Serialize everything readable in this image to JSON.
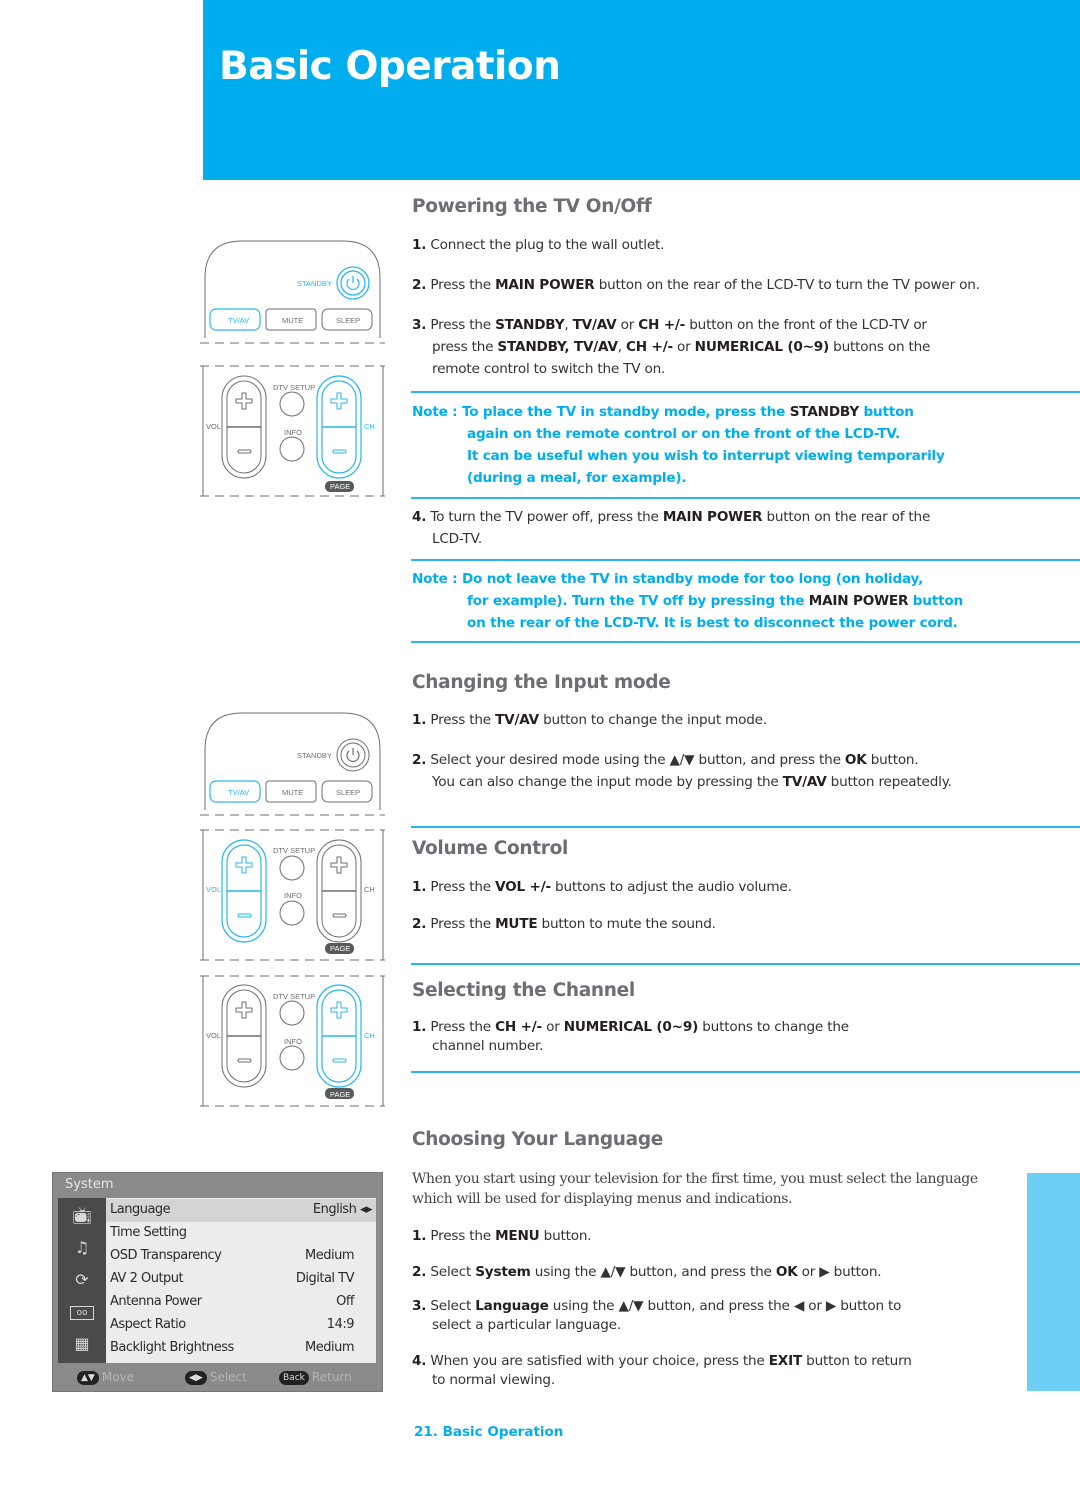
{
  "header": {
    "title": "Basic Operation"
  },
  "colors": {
    "accent": "#00aeef",
    "rule": "#29b6f0",
    "tab": "#6dcff6",
    "heading": "#6d6e71"
  },
  "sections": {
    "power": {
      "title": "Powering the TV On/Off",
      "steps": [
        {
          "num": "1.",
          "text": "Connect the plug to the wall outlet."
        },
        {
          "num": "2.",
          "pre": "Press the ",
          "b1": "MAIN POWER",
          "post": " button on the rear of the LCD-TV to turn the TV power on."
        },
        {
          "num": "3.",
          "l1_pre": "Press the ",
          "l1_b1": "STANDBY",
          "l1_s1": ", ",
          "l1_b2": "TV/AV",
          "l1_s2": " or ",
          "l1_b3": "CH +/-",
          "l1_post": " button on the front of the LCD-TV or",
          "l2_pre": "press the ",
          "l2_b1": "STANDBY, TV/AV",
          "l2_s1": ", ",
          "l2_b2": "CH +/-",
          "l2_s2": " or ",
          "l2_b3": "NUMERICAL (0~9)",
          "l2_post": " buttons on the",
          "l3": "remote control to switch the TV on."
        },
        {
          "num": "4.",
          "pre": "To turn the TV power off, press the ",
          "b1": "MAIN POWER",
          "post": " button on the rear of the",
          "l2": "LCD-TV."
        }
      ],
      "note1": {
        "prefix": "Note : ",
        "l1_pre": "To place the TV in standby mode, press the ",
        "l1_k": "STANDBY",
        "l1_post": " button",
        "l2": "again on the remote control or on the front of the LCD-TV.",
        "l3": "It can be useful when you wish to interrupt viewing temporarily",
        "l4": "(during a meal, for example)."
      },
      "note2": {
        "prefix": "Note : ",
        "l1": "Do not leave the TV in standby mode for too long (on holiday,",
        "l2_pre": "for example). Turn the TV off by pressing the ",
        "l2_k": "MAIN POWER",
        "l2_post": " button",
        "l3": "on the rear of the LCD-TV. It is best to disconnect the power cord."
      }
    },
    "input": {
      "title": "Changing the Input mode",
      "steps": [
        {
          "num": "1.",
          "pre": "Press the ",
          "b1": "TV/AV",
          "post": " button to change the input mode."
        },
        {
          "num": "2.",
          "pre": "Select your desired mode using the ▲/▼ button, and press the ",
          "b1": "OK",
          "post": " button.",
          "l2_pre": "You can also change the input mode by pressing the ",
          "l2_b": "TV/AV",
          "l2_post": " button repeatedly."
        }
      ]
    },
    "volume": {
      "title": "Volume Control",
      "steps": [
        {
          "num": "1.",
          "pre": "Press the ",
          "b1": "VOL +/-",
          "post": " buttons to adjust the audio volume."
        },
        {
          "num": "2.",
          "pre": "Press the ",
          "b1": "MUTE",
          "post": " button to mute the sound."
        }
      ]
    },
    "channel": {
      "title": "Selecting the Channel",
      "steps": [
        {
          "num": "1.",
          "pre": "Press the ",
          "b1": "CH +/-",
          "mid": " or ",
          "b2": "NUMERICAL (0~9)",
          "post": " buttons to change the",
          "l2": "channel number."
        }
      ]
    },
    "language": {
      "title": "Choosing Your Language",
      "intro_l1": "When you start using your television for the first time,  you must select the language",
      "intro_l2": "which will be used for displaying menus and indications.",
      "steps": [
        {
          "num": "1.",
          "pre": "Press the ",
          "b1": "MENU",
          "post": " button."
        },
        {
          "num": "2.",
          "pre": "Select ",
          "b1": "System",
          "mid": " using the ▲/▼ button, and press the ",
          "b2": "OK",
          "post": " or ▶ button."
        },
        {
          "num": "3.",
          "pre": "Select ",
          "b1": "Language",
          "post": " using the ▲/▼ button, and press the ◀ or ▶ button to",
          "l2": "select a particular language."
        },
        {
          "num": "4.",
          "pre": "When you are satisfied with your choice, press the ",
          "b1": "EXIT",
          "post": " button to return",
          "l2": "to normal viewing."
        }
      ]
    }
  },
  "remote": {
    "standby": "STANDBY",
    "tvav": "TV/AV",
    "mute": "MUTE",
    "sleep": "SLEEP",
    "dtv_setup": "DTV SETUP",
    "info": "INFO",
    "vol": "VOL",
    "ch": "CH",
    "page": "PAGE"
  },
  "osd_menu": {
    "title": "System",
    "icons": [
      "tv-icon",
      "music-note-icon",
      "refresh-icon",
      "tape-icon",
      "cabinet-icon"
    ],
    "rows": [
      {
        "label": "Language",
        "value": "English ◂▸",
        "selected": true
      },
      {
        "label": "Time Setting",
        "value": ""
      },
      {
        "label": "OSD Transparency",
        "value": "Medium"
      },
      {
        "label": "AV 2 Output",
        "value": "Digital TV"
      },
      {
        "label": "Antenna Power",
        "value": "Off"
      },
      {
        "label": "Aspect Ratio",
        "value": "14:9"
      },
      {
        "label": "Backlight Brightness",
        "value": "Medium"
      }
    ],
    "footer": [
      {
        "key": "▲▼",
        "label": "Move"
      },
      {
        "key": "◀▶",
        "label": "Select"
      },
      {
        "key": "Back",
        "label": "Return"
      }
    ]
  },
  "footer": {
    "page_label": "21. Basic Operation"
  }
}
